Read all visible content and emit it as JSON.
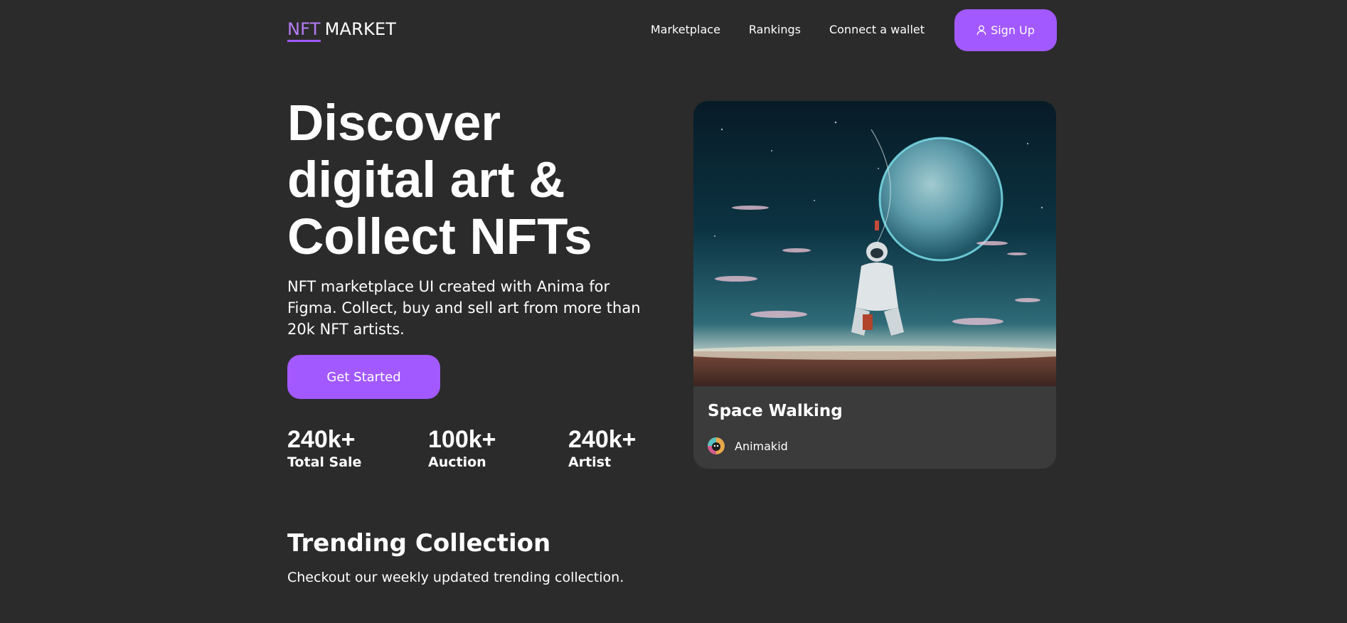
{
  "header": {
    "logo_part1": "NFT",
    "logo_part2": "MARKET",
    "nav": [
      "Marketplace",
      "Rankings",
      "Connect a wallet"
    ],
    "signup_label": "Sign Up",
    "signup_icon": "user-icon"
  },
  "hero": {
    "title_line1": "Discover",
    "title_line2": "digital art &",
    "title_line3": "Collect NFTs",
    "description": "NFT marketplace UI created with Anima for Figma. Collect, buy and sell art from more than 20k NFT artists.",
    "cta_label": "Get Started",
    "stats": [
      {
        "value": "240k+",
        "label": "Total Sale"
      },
      {
        "value": "100k+",
        "label": "Auction"
      },
      {
        "value": "240k+",
        "label": "Artist"
      }
    ]
  },
  "featured": {
    "title": "Space Walking",
    "artist": "Animakid"
  },
  "trending": {
    "title": "Trending Collection",
    "subtitle": "Checkout our weekly updated trending collection."
  },
  "colors": {
    "background": "#2b2b2b",
    "accent": "#a259ff",
    "card": "#3b3b3b",
    "text": "#ffffff"
  }
}
